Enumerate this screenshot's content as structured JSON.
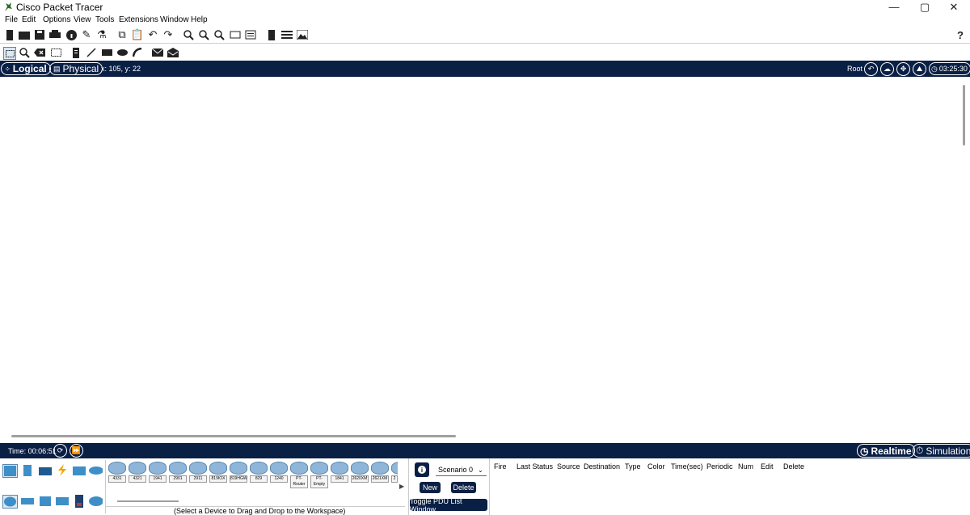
{
  "window": {
    "title": "Cisco Packet Tracer",
    "minimize": "—",
    "restore": "▢",
    "close": "✕"
  },
  "menu": [
    "File",
    "Edit",
    "Options",
    "View",
    "Tools",
    "Extensions",
    "Window",
    "Help"
  ],
  "help_icon": "?",
  "nav": {
    "logical_label": "Logical",
    "physical_label": "Physical",
    "coords": "x: 105, y: 22",
    "root_label": "Root",
    "clock": "03:25:30"
  },
  "timebar": {
    "time": "Time: 00:06:51",
    "realtime_label": "Realtime",
    "simulation_label": "Simulation"
  },
  "devices": {
    "items": [
      "4331",
      "4321",
      "1941",
      "2901",
      "2911",
      "819IOX",
      "819HGW",
      "829",
      "1240",
      "PT-Router",
      "PT-Empty",
      "1841",
      "2620XM",
      "2621XM",
      "2"
    ],
    "select_message": "(Select a Device to Drag and Drop to the Workspace)"
  },
  "scenario": {
    "info_icon": "i",
    "selected": "Scenario 0",
    "new_label": "New",
    "delete_label": "Delete",
    "toggle_label": "Toggle PDU List Window"
  },
  "pdu_columns": [
    "Fire",
    "Last Status",
    "Source",
    "Destination",
    "Type",
    "Color",
    "Time(sec)",
    "Periodic",
    "Num",
    "Edit",
    "Delete"
  ],
  "colors": {
    "navy": "#0a1f44",
    "device_blue": "#8fb6d8"
  }
}
